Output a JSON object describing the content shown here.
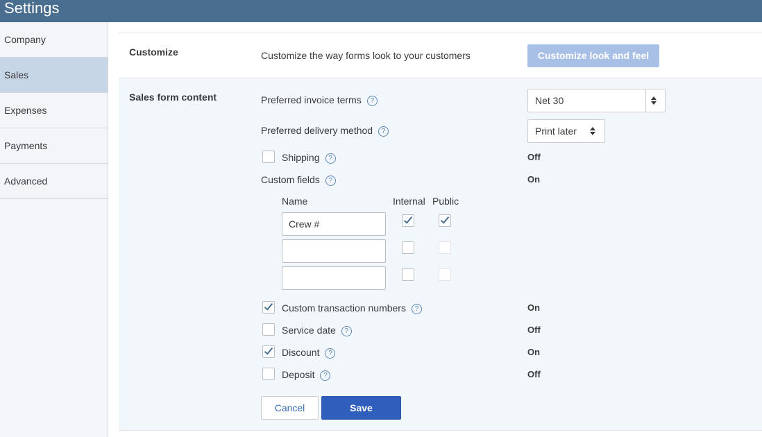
{
  "app": {
    "title": "Settings"
  },
  "sidebar": {
    "items": [
      {
        "label": "Company"
      },
      {
        "label": "Sales"
      },
      {
        "label": "Expenses"
      },
      {
        "label": "Payments"
      },
      {
        "label": "Advanced"
      }
    ],
    "active": "Sales"
  },
  "customize": {
    "label": "Customize",
    "description": "Customize the way forms look to your customers",
    "button_label": "Customize look and feel"
  },
  "sales_form": {
    "label": "Sales form content",
    "invoice_terms": {
      "label": "Preferred invoice terms",
      "value": "Net 30"
    },
    "delivery_method": {
      "label": "Preferred delivery method",
      "value": "Print later"
    },
    "shipping": {
      "label": "Shipping",
      "checked": false,
      "status": "Off"
    },
    "custom_fields": {
      "label": "Custom fields",
      "status": "On",
      "headers": {
        "name": "Name",
        "internal": "Internal",
        "public": "Public"
      },
      "rows": [
        {
          "name": "Crew #",
          "internal": true,
          "public": true
        },
        {
          "name": "",
          "internal": false,
          "public": false
        },
        {
          "name": "",
          "internal": false,
          "public": false
        }
      ]
    },
    "custom_transaction_numbers": {
      "label": "Custom transaction numbers",
      "checked": true,
      "status": "On"
    },
    "service_date": {
      "label": "Service date",
      "checked": false,
      "status": "Off"
    },
    "discount": {
      "label": "Discount",
      "checked": true,
      "status": "On"
    },
    "deposit": {
      "label": "Deposit",
      "checked": false,
      "status": "Off"
    },
    "cancel_label": "Cancel",
    "save_label": "Save"
  },
  "colors": {
    "header": "#4a6e8f",
    "sidebar_active": "#c6d6e6",
    "panel_bg": "#f2f7fc",
    "primary_button": "#2f5fbd",
    "disabled_button": "#a9c0e6"
  },
  "icons": {
    "help": "question-mark-circle-icon",
    "check": "checkmark-icon",
    "select_arrows": "up-down-arrows-icon"
  }
}
